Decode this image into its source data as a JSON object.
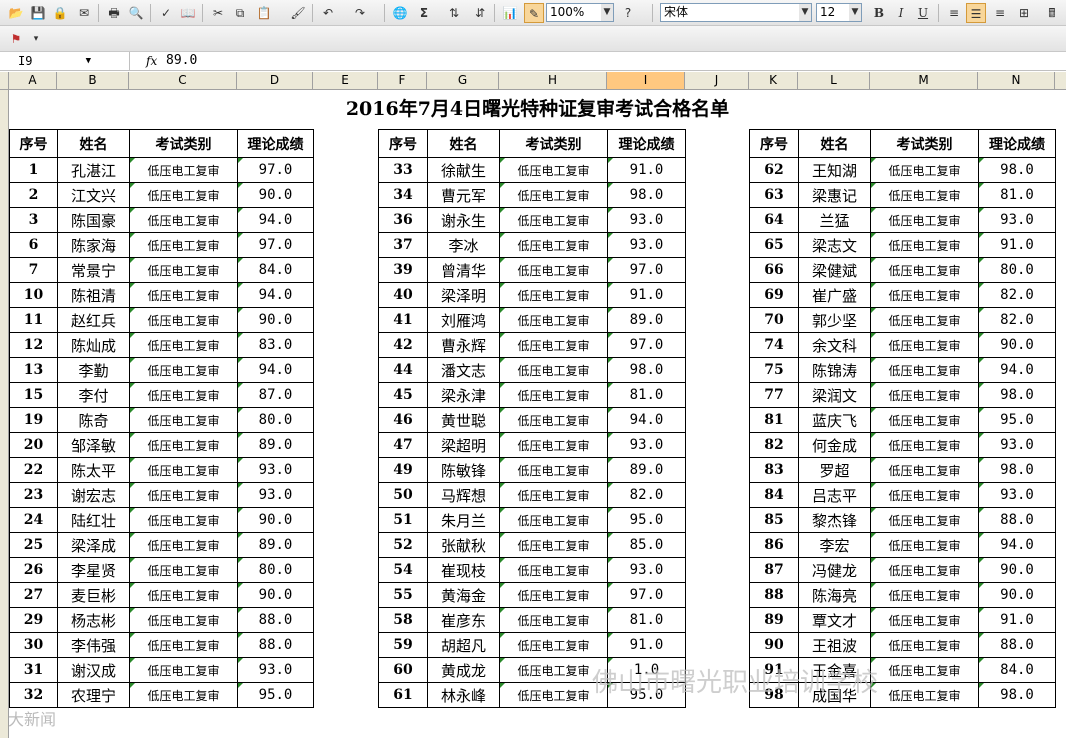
{
  "toolbar": {
    "zoom": "100%",
    "font_name": "宋体",
    "font_size": "12",
    "sum_symbol": "Σ",
    "bold": "B",
    "italic": "I",
    "underline": "U"
  },
  "formula_bar": {
    "cell_ref": "I9",
    "fx": "fx",
    "value": "89.0"
  },
  "columns": [
    "A",
    "B",
    "C",
    "D",
    "E",
    "F",
    "G",
    "H",
    "I",
    "J",
    "K",
    "L",
    "M",
    "N"
  ],
  "sheet": {
    "title": "2016年7月4日曙光特种证复审考试合格名单",
    "headers": [
      "序号",
      "姓名",
      "考试类别",
      "理论成绩"
    ],
    "category": "低压电工复审",
    "left": [
      {
        "seq": "1",
        "name": "孔湛江",
        "cat": "低压电工复审",
        "score": "97.0"
      },
      {
        "seq": "2",
        "name": "江文兴",
        "cat": "低压电工复审",
        "score": "90.0"
      },
      {
        "seq": "3",
        "name": "陈国豪",
        "cat": "低压电工复审",
        "score": "94.0"
      },
      {
        "seq": "6",
        "name": "陈家海",
        "cat": "低压电工复审",
        "score": "97.0"
      },
      {
        "seq": "7",
        "name": "常景宁",
        "cat": "低压电工复审",
        "score": "84.0"
      },
      {
        "seq": "10",
        "name": "陈祖清",
        "cat": "低压电工复审",
        "score": "94.0"
      },
      {
        "seq": "11",
        "name": "赵红兵",
        "cat": "低压电工复审",
        "score": "90.0"
      },
      {
        "seq": "12",
        "name": "陈灿成",
        "cat": "低压电工复审",
        "score": "83.0"
      },
      {
        "seq": "13",
        "name": "李勤",
        "cat": "低压电工复审",
        "score": "94.0"
      },
      {
        "seq": "15",
        "name": "李付",
        "cat": "低压电工复审",
        "score": "87.0"
      },
      {
        "seq": "19",
        "name": "陈奇",
        "cat": "低压电工复审",
        "score": "80.0"
      },
      {
        "seq": "20",
        "name": "邹泽敏",
        "cat": "低压电工复审",
        "score": "89.0"
      },
      {
        "seq": "22",
        "name": "陈太平",
        "cat": "低压电工复审",
        "score": "93.0"
      },
      {
        "seq": "23",
        "name": "谢宏志",
        "cat": "低压电工复审",
        "score": "93.0"
      },
      {
        "seq": "24",
        "name": "陆红壮",
        "cat": "低压电工复审",
        "score": "90.0"
      },
      {
        "seq": "25",
        "name": "梁泽成",
        "cat": "低压电工复审",
        "score": "89.0"
      },
      {
        "seq": "26",
        "name": "李星贤",
        "cat": "低压电工复审",
        "score": "80.0"
      },
      {
        "seq": "27",
        "name": "麦巨彬",
        "cat": "低压电工复审",
        "score": "90.0"
      },
      {
        "seq": "29",
        "name": "杨志彬",
        "cat": "低压电工复审",
        "score": "88.0"
      },
      {
        "seq": "30",
        "name": "李伟强",
        "cat": "低压电工复审",
        "score": "88.0"
      },
      {
        "seq": "31",
        "name": "谢汉成",
        "cat": "低压电工复审",
        "score": "93.0"
      },
      {
        "seq": "32",
        "name": "农理宁",
        "cat": "低压电工复审",
        "score": "95.0"
      }
    ],
    "middle": [
      {
        "seq": "33",
        "name": "徐献生",
        "cat": "低压电工复审",
        "score": "91.0"
      },
      {
        "seq": "34",
        "name": "曹元军",
        "cat": "低压电工复审",
        "score": "98.0"
      },
      {
        "seq": "36",
        "name": "谢永生",
        "cat": "低压电工复审",
        "score": "93.0"
      },
      {
        "seq": "37",
        "name": "李冰",
        "cat": "低压电工复审",
        "score": "93.0"
      },
      {
        "seq": "39",
        "name": "曾清华",
        "cat": "低压电工复审",
        "score": "97.0"
      },
      {
        "seq": "40",
        "name": "梁泽明",
        "cat": "低压电工复审",
        "score": "91.0"
      },
      {
        "seq": "41",
        "name": "刘雁鸿",
        "cat": "低压电工复审",
        "score": "89.0"
      },
      {
        "seq": "42",
        "name": "曹永辉",
        "cat": "低压电工复审",
        "score": "97.0"
      },
      {
        "seq": "44",
        "name": "潘文志",
        "cat": "低压电工复审",
        "score": "98.0"
      },
      {
        "seq": "45",
        "name": "梁永津",
        "cat": "低压电工复审",
        "score": "81.0"
      },
      {
        "seq": "46",
        "name": "黄世聪",
        "cat": "低压电工复审",
        "score": "94.0"
      },
      {
        "seq": "47",
        "name": "梁超明",
        "cat": "低压电工复审",
        "score": "93.0"
      },
      {
        "seq": "49",
        "name": "陈敏锋",
        "cat": "低压电工复审",
        "score": "89.0"
      },
      {
        "seq": "50",
        "name": "马辉想",
        "cat": "低压电工复审",
        "score": "82.0"
      },
      {
        "seq": "51",
        "name": "朱月兰",
        "cat": "低压电工复审",
        "score": "95.0"
      },
      {
        "seq": "52",
        "name": "张献秋",
        "cat": "低压电工复审",
        "score": "85.0"
      },
      {
        "seq": "54",
        "name": "崔现枝",
        "cat": "低压电工复审",
        "score": "93.0"
      },
      {
        "seq": "55",
        "name": "黄海金",
        "cat": "低压电工复审",
        "score": "97.0"
      },
      {
        "seq": "58",
        "name": "崔彦东",
        "cat": "低压电工复审",
        "score": "81.0"
      },
      {
        "seq": "59",
        "name": "胡超凡",
        "cat": "低压电工复审",
        "score": "91.0"
      },
      {
        "seq": "60",
        "name": "黄成龙",
        "cat": "低压电工复审",
        "score": "1.0"
      },
      {
        "seq": "61",
        "name": "林永峰",
        "cat": "低压电工复审",
        "score": "95.0"
      }
    ],
    "right": [
      {
        "seq": "62",
        "name": "王知湖",
        "cat": "低压电工复审",
        "score": "98.0"
      },
      {
        "seq": "63",
        "name": "梁惠记",
        "cat": "低压电工复审",
        "score": "81.0"
      },
      {
        "seq": "64",
        "name": "兰猛",
        "cat": "低压电工复审",
        "score": "93.0"
      },
      {
        "seq": "65",
        "name": "梁志文",
        "cat": "低压电工复审",
        "score": "91.0"
      },
      {
        "seq": "66",
        "name": "梁健斌",
        "cat": "低压电工复审",
        "score": "80.0"
      },
      {
        "seq": "69",
        "name": "崔广盛",
        "cat": "低压电工复审",
        "score": "82.0"
      },
      {
        "seq": "70",
        "name": "郭少坚",
        "cat": "低压电工复审",
        "score": "82.0"
      },
      {
        "seq": "74",
        "name": "余文科",
        "cat": "低压电工复审",
        "score": "90.0"
      },
      {
        "seq": "75",
        "name": "陈锦涛",
        "cat": "低压电工复审",
        "score": "94.0"
      },
      {
        "seq": "77",
        "name": "梁润文",
        "cat": "低压电工复审",
        "score": "98.0"
      },
      {
        "seq": "81",
        "name": "蓝庆飞",
        "cat": "低压电工复审",
        "score": "95.0"
      },
      {
        "seq": "82",
        "name": "何金成",
        "cat": "低压电工复审",
        "score": "93.0"
      },
      {
        "seq": "83",
        "name": "罗超",
        "cat": "低压电工复审",
        "score": "98.0"
      },
      {
        "seq": "84",
        "name": "吕志平",
        "cat": "低压电工复审",
        "score": "93.0"
      },
      {
        "seq": "85",
        "name": "黎杰锋",
        "cat": "低压电工复审",
        "score": "88.0"
      },
      {
        "seq": "86",
        "name": "李宏",
        "cat": "低压电工复审",
        "score": "94.0"
      },
      {
        "seq": "87",
        "name": "冯健龙",
        "cat": "低压电工复审",
        "score": "90.0"
      },
      {
        "seq": "88",
        "name": "陈海亮",
        "cat": "低压电工复审",
        "score": "90.0"
      },
      {
        "seq": "89",
        "name": "覃文才",
        "cat": "低压电工复审",
        "score": "91.0"
      },
      {
        "seq": "90",
        "name": "王祖波",
        "cat": "低压电工复审",
        "score": "88.0"
      },
      {
        "seq": "91",
        "name": "王金喜",
        "cat": "低压电工复审",
        "score": "84.0"
      },
      {
        "seq": "98",
        "name": "成国华",
        "cat": "低压电工复审",
        "score": "98.0"
      }
    ]
  },
  "watermark": "佛山市曙光职业培训学校",
  "watermark_corner": "大新闻"
}
